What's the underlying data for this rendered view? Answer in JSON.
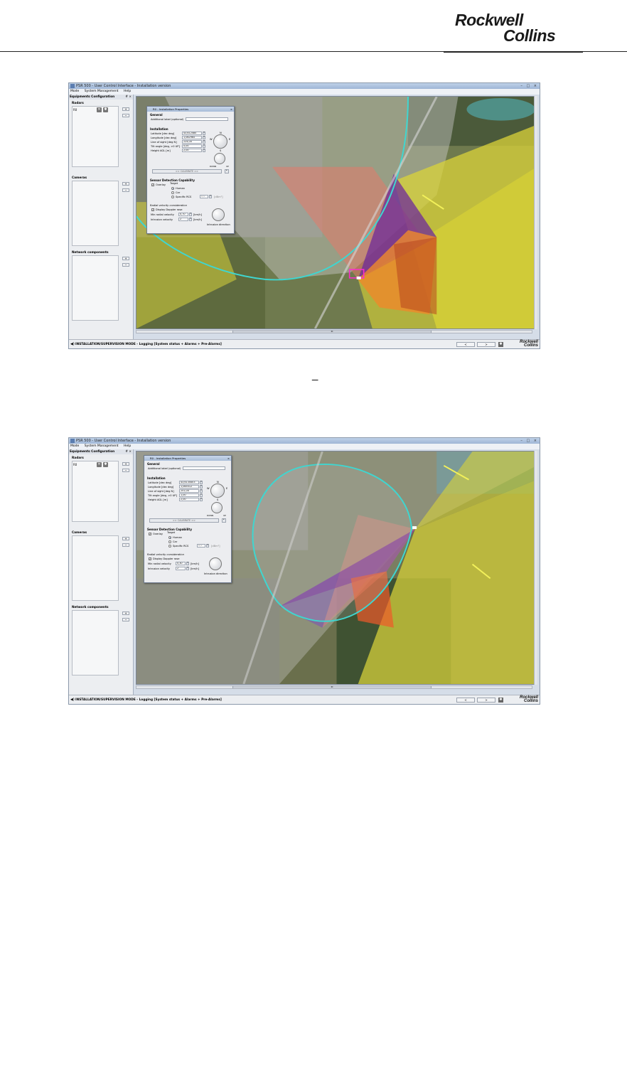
{
  "header": {
    "logo_line1": "Rockwell",
    "logo_line2": "Collins",
    "separator": "_"
  },
  "app": {
    "window_title": "PSR 500 - User Control Interface - Installation version",
    "menu": [
      "Mode",
      "System Management",
      "Help"
    ],
    "panel_title": "Equipments Configuration",
    "panel_pins": "# ×",
    "sections": {
      "radars": "Radars",
      "cameras": "Cameras",
      "network": "Network components"
    },
    "radar_item": "R0",
    "add_label": "+",
    "remove_label": "−",
    "status_text": "INSTALLATION/SUPERVISION MODE - Logging [System status + Alarms + Pre-Alarms]",
    "status_btn_prev": "<",
    "status_btn_next": ">",
    "status_logo_1": "Rockwell",
    "status_logo_2": "Collins",
    "scroll_marker": "III"
  },
  "dialog1": {
    "title": "R0 - Installation Properties",
    "general": "General",
    "additional_label": "Additional label (optional)",
    "installation": "Installation",
    "latitude_label": "Latitude [dec deg]",
    "latitude_value": "43,612480",
    "longitude_label": "Longitude [dec deg]",
    "longitude_value": "1,062965",
    "los_label": "Line of sight [deg N]",
    "los_value": "224,00",
    "tilt_label": "Tilt angle [deg, >0 UP]",
    "tilt_value": "0,00",
    "height_label": "Height AGL [m]",
    "height_value": "2,00",
    "n": "N",
    "w": "W",
    "e": "E",
    "s": "S",
    "down": "DOWN",
    "up": "UP",
    "calibrate": ">> CALIBRATE >>",
    "sdc": "Sensor Detection Capability",
    "overlay": "Overlay",
    "target": "Target",
    "human": "Human",
    "car": "Car",
    "specific_rcs": "Specific RCS",
    "rcs_value": "0,0",
    "rcs_unit": "[dBm²]",
    "radial": "Radial velocity consideration",
    "doppler": "Display Doppler rose",
    "min_radial": "Min radial velocity",
    "min_radial_value": "0,70",
    "unit_kmh": "[km/h]",
    "intrusion_velocity": "Intrusion velocity",
    "intrusion_velocity_value": "2",
    "intrusion_direction": "Intrusion direction"
  },
  "dialog2": {
    "title": "R0 - Installation Properties",
    "general": "General",
    "additional_label": "Additional label (optional)",
    "installation": "Installation",
    "latitude_label": "Latitude [dec deg]",
    "latitude_value": "43,6134403",
    "longitude_label": "Longitude [dec deg]",
    "longitude_value": "1,065512",
    "los_label": "Line of sight [deg N]",
    "los_value": "251,00",
    "tilt_label": "Tilt angle [deg, >0 UP]",
    "tilt_value": "1,00",
    "height_label": "Height AGL [m]",
    "height_value": "2,00",
    "n": "N",
    "w": "W",
    "e": "E",
    "s": "S",
    "down": "DOWN",
    "up": "UP",
    "calibrate": ">> CALIBRATE >>",
    "sdc": "Sensor Detection Capability",
    "overlay": "Overlay",
    "target": "Target",
    "human": "Human",
    "car": "Car",
    "specific_rcs": "Specific RCS",
    "rcs_value": "0,0",
    "rcs_unit": "[dBm²]",
    "radial": "Radial velocity consideration",
    "doppler": "Display Doppler rose",
    "min_radial": "Min radial velocity",
    "min_radial_value": "0,30",
    "unit_kmh": "[km/h]",
    "intrusion_velocity": "Intrusion velocity",
    "intrusion_velocity_value": "2",
    "intrusion_direction": "Intrusion direction"
  },
  "icons": {
    "speaker": "speaker-icon",
    "gear": "gear-icon",
    "tool": "wrench-icon",
    "close": "close-icon"
  },
  "colors": {
    "coverage_yellow": "#e6e23a",
    "coverage_orange": "#ef8a2a",
    "coverage_purple": "#6e2a9a",
    "range_circle": "#3fd6d0",
    "map_base": "#6d7650",
    "title_gradient": "#a8bcd8"
  }
}
